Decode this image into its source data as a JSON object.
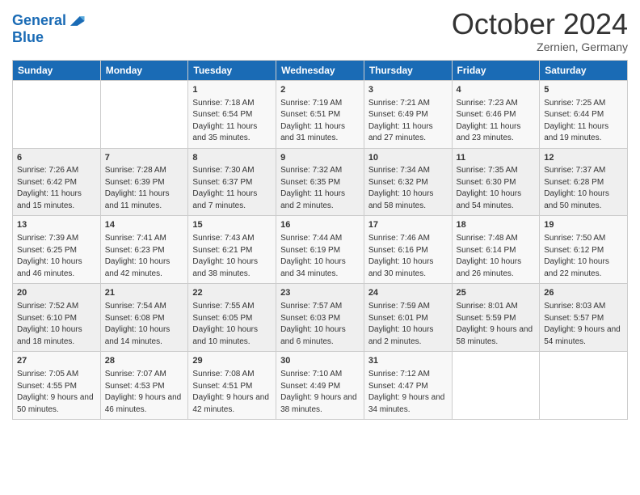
{
  "header": {
    "logo_line1": "General",
    "logo_line2": "Blue",
    "month": "October 2024",
    "location": "Zernien, Germany"
  },
  "days_of_week": [
    "Sunday",
    "Monday",
    "Tuesday",
    "Wednesday",
    "Thursday",
    "Friday",
    "Saturday"
  ],
  "weeks": [
    [
      {
        "day": "",
        "data": ""
      },
      {
        "day": "",
        "data": ""
      },
      {
        "day": "1",
        "data": "Sunrise: 7:18 AM\nSunset: 6:54 PM\nDaylight: 11 hours and 35 minutes."
      },
      {
        "day": "2",
        "data": "Sunrise: 7:19 AM\nSunset: 6:51 PM\nDaylight: 11 hours and 31 minutes."
      },
      {
        "day": "3",
        "data": "Sunrise: 7:21 AM\nSunset: 6:49 PM\nDaylight: 11 hours and 27 minutes."
      },
      {
        "day": "4",
        "data": "Sunrise: 7:23 AM\nSunset: 6:46 PM\nDaylight: 11 hours and 23 minutes."
      },
      {
        "day": "5",
        "data": "Sunrise: 7:25 AM\nSunset: 6:44 PM\nDaylight: 11 hours and 19 minutes."
      }
    ],
    [
      {
        "day": "6",
        "data": "Sunrise: 7:26 AM\nSunset: 6:42 PM\nDaylight: 11 hours and 15 minutes."
      },
      {
        "day": "7",
        "data": "Sunrise: 7:28 AM\nSunset: 6:39 PM\nDaylight: 11 hours and 11 minutes."
      },
      {
        "day": "8",
        "data": "Sunrise: 7:30 AM\nSunset: 6:37 PM\nDaylight: 11 hours and 7 minutes."
      },
      {
        "day": "9",
        "data": "Sunrise: 7:32 AM\nSunset: 6:35 PM\nDaylight: 11 hours and 2 minutes."
      },
      {
        "day": "10",
        "data": "Sunrise: 7:34 AM\nSunset: 6:32 PM\nDaylight: 10 hours and 58 minutes."
      },
      {
        "day": "11",
        "data": "Sunrise: 7:35 AM\nSunset: 6:30 PM\nDaylight: 10 hours and 54 minutes."
      },
      {
        "day": "12",
        "data": "Sunrise: 7:37 AM\nSunset: 6:28 PM\nDaylight: 10 hours and 50 minutes."
      }
    ],
    [
      {
        "day": "13",
        "data": "Sunrise: 7:39 AM\nSunset: 6:25 PM\nDaylight: 10 hours and 46 minutes."
      },
      {
        "day": "14",
        "data": "Sunrise: 7:41 AM\nSunset: 6:23 PM\nDaylight: 10 hours and 42 minutes."
      },
      {
        "day": "15",
        "data": "Sunrise: 7:43 AM\nSunset: 6:21 PM\nDaylight: 10 hours and 38 minutes."
      },
      {
        "day": "16",
        "data": "Sunrise: 7:44 AM\nSunset: 6:19 PM\nDaylight: 10 hours and 34 minutes."
      },
      {
        "day": "17",
        "data": "Sunrise: 7:46 AM\nSunset: 6:16 PM\nDaylight: 10 hours and 30 minutes."
      },
      {
        "day": "18",
        "data": "Sunrise: 7:48 AM\nSunset: 6:14 PM\nDaylight: 10 hours and 26 minutes."
      },
      {
        "day": "19",
        "data": "Sunrise: 7:50 AM\nSunset: 6:12 PM\nDaylight: 10 hours and 22 minutes."
      }
    ],
    [
      {
        "day": "20",
        "data": "Sunrise: 7:52 AM\nSunset: 6:10 PM\nDaylight: 10 hours and 18 minutes."
      },
      {
        "day": "21",
        "data": "Sunrise: 7:54 AM\nSunset: 6:08 PM\nDaylight: 10 hours and 14 minutes."
      },
      {
        "day": "22",
        "data": "Sunrise: 7:55 AM\nSunset: 6:05 PM\nDaylight: 10 hours and 10 minutes."
      },
      {
        "day": "23",
        "data": "Sunrise: 7:57 AM\nSunset: 6:03 PM\nDaylight: 10 hours and 6 minutes."
      },
      {
        "day": "24",
        "data": "Sunrise: 7:59 AM\nSunset: 6:01 PM\nDaylight: 10 hours and 2 minutes."
      },
      {
        "day": "25",
        "data": "Sunrise: 8:01 AM\nSunset: 5:59 PM\nDaylight: 9 hours and 58 minutes."
      },
      {
        "day": "26",
        "data": "Sunrise: 8:03 AM\nSunset: 5:57 PM\nDaylight: 9 hours and 54 minutes."
      }
    ],
    [
      {
        "day": "27",
        "data": "Sunrise: 7:05 AM\nSunset: 4:55 PM\nDaylight: 9 hours and 50 minutes."
      },
      {
        "day": "28",
        "data": "Sunrise: 7:07 AM\nSunset: 4:53 PM\nDaylight: 9 hours and 46 minutes."
      },
      {
        "day": "29",
        "data": "Sunrise: 7:08 AM\nSunset: 4:51 PM\nDaylight: 9 hours and 42 minutes."
      },
      {
        "day": "30",
        "data": "Sunrise: 7:10 AM\nSunset: 4:49 PM\nDaylight: 9 hours and 38 minutes."
      },
      {
        "day": "31",
        "data": "Sunrise: 7:12 AM\nSunset: 4:47 PM\nDaylight: 9 hours and 34 minutes."
      },
      {
        "day": "",
        "data": ""
      },
      {
        "day": "",
        "data": ""
      }
    ]
  ]
}
